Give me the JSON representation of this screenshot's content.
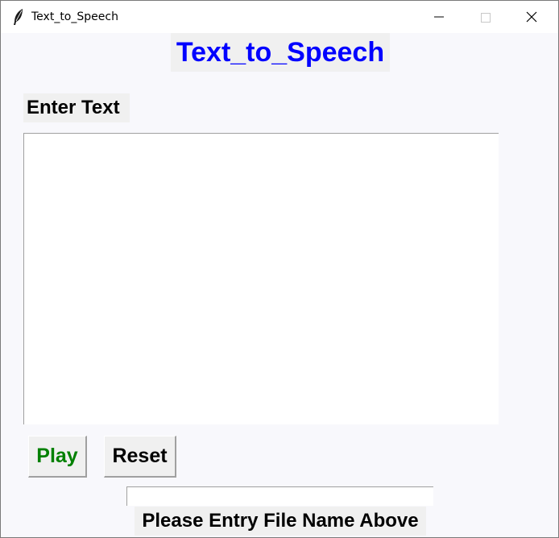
{
  "window": {
    "title": "Text_to_Speech",
    "icon": "feather-icon",
    "controls": [
      "minimize-icon",
      "maximize-icon",
      "close-icon"
    ]
  },
  "main": {
    "heading": "Text_to_Speech",
    "heading_color": "#0000ff",
    "enter_label": "Enter Text",
    "text_value": "",
    "play_label": "Play",
    "play_color": "#008000",
    "reset_label": "Reset",
    "filename_value": "",
    "filename_label": "Please Entry File Name Above"
  }
}
